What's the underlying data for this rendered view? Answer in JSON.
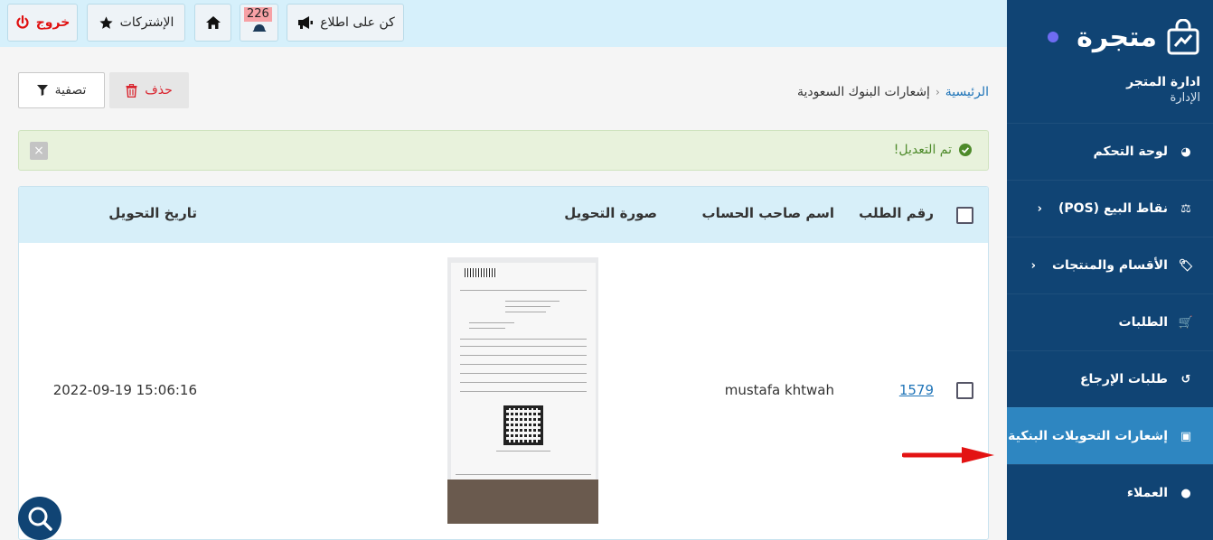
{
  "brand": {
    "name": "متجرة"
  },
  "store": {
    "title": "ادارة المتجر",
    "subtitle": "الإدارة"
  },
  "sidebar": {
    "items": [
      {
        "label": "لوحة التحكم",
        "icon": "dashboard-icon",
        "glyph": "◕",
        "chevron": ""
      },
      {
        "label": "نقاط البيع (POS)",
        "icon": "scales-icon",
        "glyph": "⚖",
        "chevron": "‹"
      },
      {
        "label": "الأقسام والمنتجات",
        "icon": "tag-icon",
        "glyph": "🏷",
        "chevron": "‹"
      },
      {
        "label": "الطلبات",
        "icon": "cart-icon",
        "glyph": "🛒",
        "chevron": ""
      },
      {
        "label": "طلبات الإرجاع",
        "icon": "undo-icon",
        "glyph": "↺",
        "chevron": ""
      },
      {
        "label": "إشعارات التحويلات البنكية",
        "icon": "money-icon",
        "glyph": "▣",
        "chevron": ""
      },
      {
        "label": "العملاء",
        "icon": "user-icon",
        "glyph": "●",
        "chevron": ""
      }
    ],
    "active_index": 5
  },
  "topbar": {
    "logout_label": "خروج",
    "subscriptions_label": "الإشتركات",
    "notifications_count": "226",
    "announce_label": "كن على اطلاع"
  },
  "breadcrumb": {
    "home": "الرئيسية",
    "separator": "‹",
    "current": "إشعارات البنوك السعودية"
  },
  "actions": {
    "delete_label": "حذف",
    "filter_label": "تصفية"
  },
  "alert": {
    "message": "تم التعديل!",
    "close_glyph": "×"
  },
  "table": {
    "columns": {
      "order_no": "رقم الطلب",
      "account_holder": "اسم صاحب الحساب",
      "transfer_image": "صورة التحويل",
      "transfer_date": "تاريخ التحويل"
    },
    "rows": [
      {
        "order_no": "1579",
        "account_holder": "mustafa khtwah",
        "transfer_date": "2022-09-19 15:06:16"
      }
    ]
  },
  "colors": {
    "sidebar_bg": "#104474",
    "sidebar_active": "#2e86c1",
    "topbar_bg": "#d6f0fb",
    "table_head_bg": "#d7eff9",
    "alert_bg": "#e8f2dc",
    "danger": "#d9232d",
    "link": "#1f74b8"
  }
}
